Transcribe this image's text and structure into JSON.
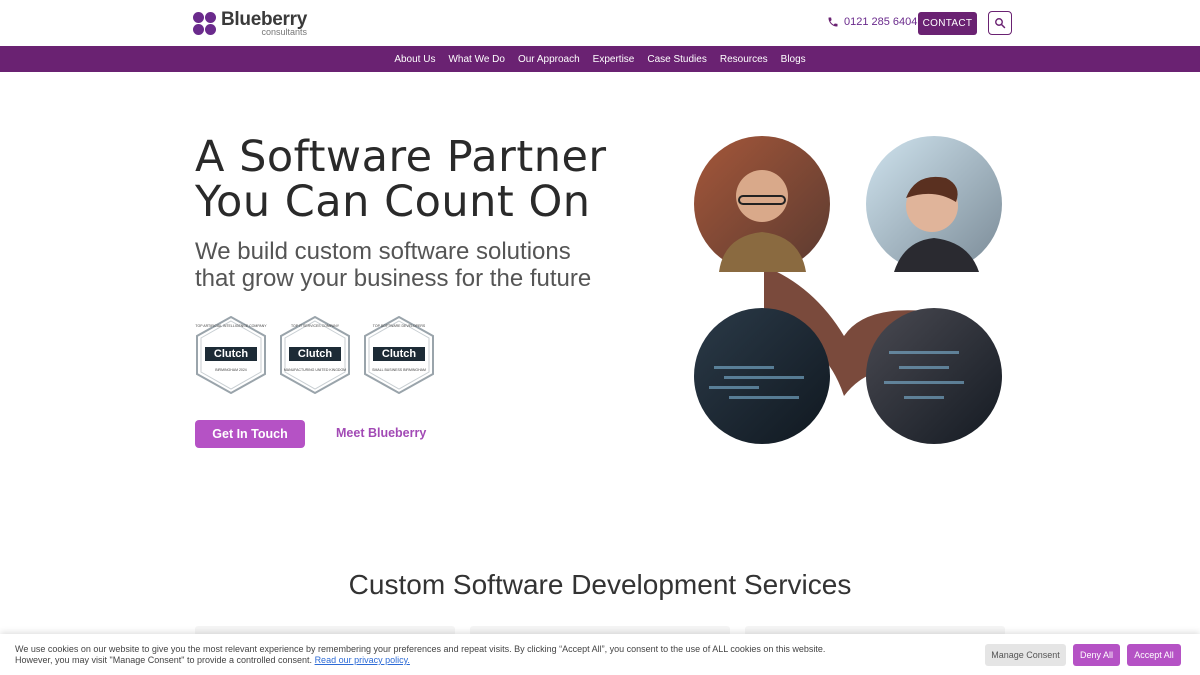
{
  "header": {
    "logo_name": "Blueberry",
    "logo_sub": "consultants",
    "phone": "0121 285 6404",
    "contact_label": "CONTACT"
  },
  "nav": {
    "items": [
      "About Us",
      "What We Do",
      "Our Approach",
      "Expertise",
      "Case Studies",
      "Resources",
      "Blogs"
    ]
  },
  "hero": {
    "title_line1": "A Software Partner",
    "title_line2": "You Can Count On",
    "subtitle_line1": "We build custom software solutions",
    "subtitle_line2": "that grow your business for the future",
    "primary_button": "Get In Touch",
    "secondary_link": "Meet Blueberry"
  },
  "badges": [
    {
      "top": "TOP ARTIFICIAL INTELLIGENCE COMPANY",
      "brand": "Clutch",
      "bottom": "BIRMINGHAM 2024"
    },
    {
      "top": "TOP IT SERVICES COMPANY",
      "brand": "Clutch",
      "bottom": "MANUFACTURING UNITED KINGDOM"
    },
    {
      "top": "TOP SOFTWARE DEVELOPERS",
      "brand": "Clutch",
      "bottom": "SMALL BUSINESS BIRMINGHAM"
    }
  ],
  "section": {
    "title": "Custom Software Development Services"
  },
  "cookie": {
    "text": "We use cookies on our website to give you the most relevant experience by remembering your preferences and repeat visits. By clicking “Accept All”, you consent to the use of ALL cookies on this website. However, you may visit \"Manage Consent\" to provide a controlled consent.",
    "link": "Read our privacy policy.",
    "manage": "Manage Consent",
    "deny": "Deny All",
    "accept": "Accept All"
  },
  "colors": {
    "brand_purple": "#6a2272",
    "accent_purple": "#b552c5"
  }
}
